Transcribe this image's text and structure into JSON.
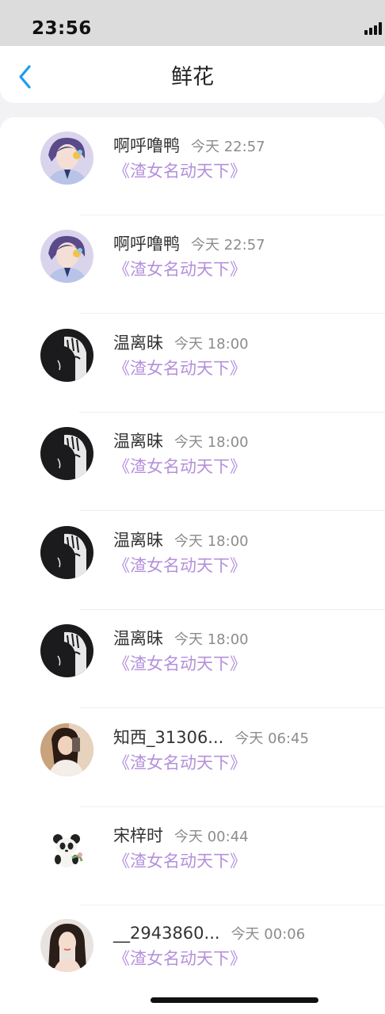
{
  "status_bar": {
    "time": "23:56"
  },
  "header": {
    "title": "鲜花"
  },
  "items": [
    {
      "name": "啊呼噜鸭",
      "time": "今天 22:57",
      "book": "《渣女名动天下》",
      "avatar": "avatar-anime-boy"
    },
    {
      "name": "啊呼噜鸭",
      "time": "今天 22:57",
      "book": "《渣女名动天下》",
      "avatar": "avatar-anime-boy"
    },
    {
      "name": "温离昧",
      "time": "今天 18:00",
      "book": "《渣女名动天下》",
      "avatar": "avatar-anime-girl-dark"
    },
    {
      "name": "温离昧",
      "time": "今天 18:00",
      "book": "《渣女名动天下》",
      "avatar": "avatar-anime-girl-dark"
    },
    {
      "name": "温离昧",
      "time": "今天 18:00",
      "book": "《渣女名动天下》",
      "avatar": "avatar-anime-girl-dark"
    },
    {
      "name": "温离昧",
      "time": "今天 18:00",
      "book": "《渣女名动天下》",
      "avatar": "avatar-anime-girl-dark"
    },
    {
      "name": "知西_31306...",
      "time": "今天 06:45",
      "book": "《渣女名动天下》",
      "avatar": "avatar-photo-girl"
    },
    {
      "name": "宋梓时",
      "time": "今天 00:44",
      "book": "《渣女名动天下》",
      "avatar": "avatar-panda"
    },
    {
      "name": "__2943860...",
      "time": "今天 00:06",
      "book": "《渣女名动天下》",
      "avatar": "avatar-photo-woman"
    }
  ],
  "colors": {
    "accent": "#1e9bf0",
    "book_title": "#b490dc",
    "time_text": "#8c8c8c"
  }
}
